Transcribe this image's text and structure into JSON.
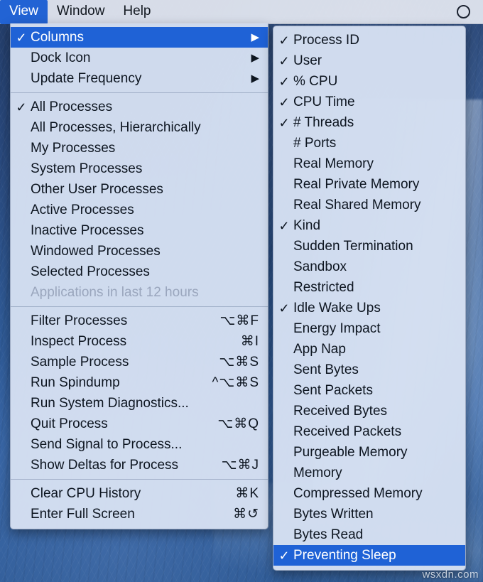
{
  "menubar": {
    "items": [
      {
        "label": "View",
        "active": true
      },
      {
        "label": "Window",
        "active": false
      },
      {
        "label": "Help",
        "active": false
      }
    ],
    "status_icon": "circle-icon"
  },
  "view_menu": {
    "sections": [
      {
        "items": [
          {
            "label": "Columns",
            "checked": true,
            "submenu": true,
            "selected": true,
            "shortcut": ""
          },
          {
            "label": "Dock Icon",
            "checked": false,
            "submenu": true,
            "selected": false,
            "shortcut": ""
          },
          {
            "label": "Update Frequency",
            "checked": false,
            "submenu": true,
            "selected": false,
            "shortcut": ""
          }
        ]
      },
      {
        "items": [
          {
            "label": "All Processes",
            "checked": true,
            "submenu": false,
            "selected": false,
            "shortcut": ""
          },
          {
            "label": "All Processes, Hierarchically",
            "checked": false,
            "submenu": false,
            "selected": false,
            "shortcut": ""
          },
          {
            "label": "My Processes",
            "checked": false,
            "submenu": false,
            "selected": false,
            "shortcut": ""
          },
          {
            "label": "System Processes",
            "checked": false,
            "submenu": false,
            "selected": false,
            "shortcut": ""
          },
          {
            "label": "Other User Processes",
            "checked": false,
            "submenu": false,
            "selected": false,
            "shortcut": ""
          },
          {
            "label": "Active Processes",
            "checked": false,
            "submenu": false,
            "selected": false,
            "shortcut": ""
          },
          {
            "label": "Inactive Processes",
            "checked": false,
            "submenu": false,
            "selected": false,
            "shortcut": ""
          },
          {
            "label": "Windowed Processes",
            "checked": false,
            "submenu": false,
            "selected": false,
            "shortcut": ""
          },
          {
            "label": "Selected Processes",
            "checked": false,
            "submenu": false,
            "selected": false,
            "shortcut": ""
          },
          {
            "label": "Applications in last 12 hours",
            "checked": false,
            "submenu": false,
            "selected": false,
            "disabled": true,
            "shortcut": ""
          }
        ]
      },
      {
        "items": [
          {
            "label": "Filter Processes",
            "checked": false,
            "submenu": false,
            "selected": false,
            "shortcut": "⌥⌘F"
          },
          {
            "label": "Inspect Process",
            "checked": false,
            "submenu": false,
            "selected": false,
            "shortcut": "⌘I"
          },
          {
            "label": "Sample Process",
            "checked": false,
            "submenu": false,
            "selected": false,
            "shortcut": "⌥⌘S"
          },
          {
            "label": "Run Spindump",
            "checked": false,
            "submenu": false,
            "selected": false,
            "shortcut": "^⌥⌘S"
          },
          {
            "label": "Run System Diagnostics...",
            "checked": false,
            "submenu": false,
            "selected": false,
            "shortcut": ""
          },
          {
            "label": "Quit Process",
            "checked": false,
            "submenu": false,
            "selected": false,
            "shortcut": "⌥⌘Q"
          },
          {
            "label": "Send Signal to Process...",
            "checked": false,
            "submenu": false,
            "selected": false,
            "shortcut": ""
          },
          {
            "label": "Show Deltas for Process",
            "checked": false,
            "submenu": false,
            "selected": false,
            "shortcut": "⌥⌘J"
          }
        ]
      },
      {
        "items": [
          {
            "label": "Clear CPU History",
            "checked": false,
            "submenu": false,
            "selected": false,
            "shortcut": "⌘K"
          },
          {
            "label": "Enter Full Screen",
            "checked": false,
            "submenu": false,
            "selected": false,
            "shortcut": "⌘↺"
          }
        ]
      }
    ]
  },
  "columns_submenu": {
    "items": [
      {
        "label": "Process ID",
        "checked": true,
        "selected": false
      },
      {
        "label": "User",
        "checked": true,
        "selected": false
      },
      {
        "label": "% CPU",
        "checked": true,
        "selected": false
      },
      {
        "label": "CPU Time",
        "checked": true,
        "selected": false
      },
      {
        "label": "# Threads",
        "checked": true,
        "selected": false
      },
      {
        "label": "# Ports",
        "checked": false,
        "selected": false
      },
      {
        "label": "Real Memory",
        "checked": false,
        "selected": false
      },
      {
        "label": "Real Private Memory",
        "checked": false,
        "selected": false
      },
      {
        "label": "Real Shared Memory",
        "checked": false,
        "selected": false
      },
      {
        "label": "Kind",
        "checked": true,
        "selected": false
      },
      {
        "label": "Sudden Termination",
        "checked": false,
        "selected": false
      },
      {
        "label": "Sandbox",
        "checked": false,
        "selected": false
      },
      {
        "label": "Restricted",
        "checked": false,
        "selected": false
      },
      {
        "label": "Idle Wake Ups",
        "checked": true,
        "selected": false
      },
      {
        "label": "Energy Impact",
        "checked": false,
        "selected": false
      },
      {
        "label": "App Nap",
        "checked": false,
        "selected": false
      },
      {
        "label": "Sent Bytes",
        "checked": false,
        "selected": false
      },
      {
        "label": "Sent Packets",
        "checked": false,
        "selected": false
      },
      {
        "label": "Received Bytes",
        "checked": false,
        "selected": false
      },
      {
        "label": "Received Packets",
        "checked": false,
        "selected": false
      },
      {
        "label": "Purgeable Memory",
        "checked": false,
        "selected": false
      },
      {
        "label": "Memory",
        "checked": false,
        "selected": false
      },
      {
        "label": "Compressed Memory",
        "checked": false,
        "selected": false
      },
      {
        "label": "Bytes Written",
        "checked": false,
        "selected": false
      },
      {
        "label": "Bytes Read",
        "checked": false,
        "selected": false
      },
      {
        "label": "Preventing Sleep",
        "checked": true,
        "selected": true
      }
    ]
  },
  "watermark": {
    "text": "wsxdn.com"
  },
  "glyphs": {
    "checkmark": "✓",
    "submenu_arrow": "▶"
  },
  "colors": {
    "highlight": "#1f62d6",
    "menubar_highlight": "#2263d4",
    "menu_background": "#d6e0f2",
    "text": "#0d1520",
    "disabled_text": "#9aa6bd"
  }
}
